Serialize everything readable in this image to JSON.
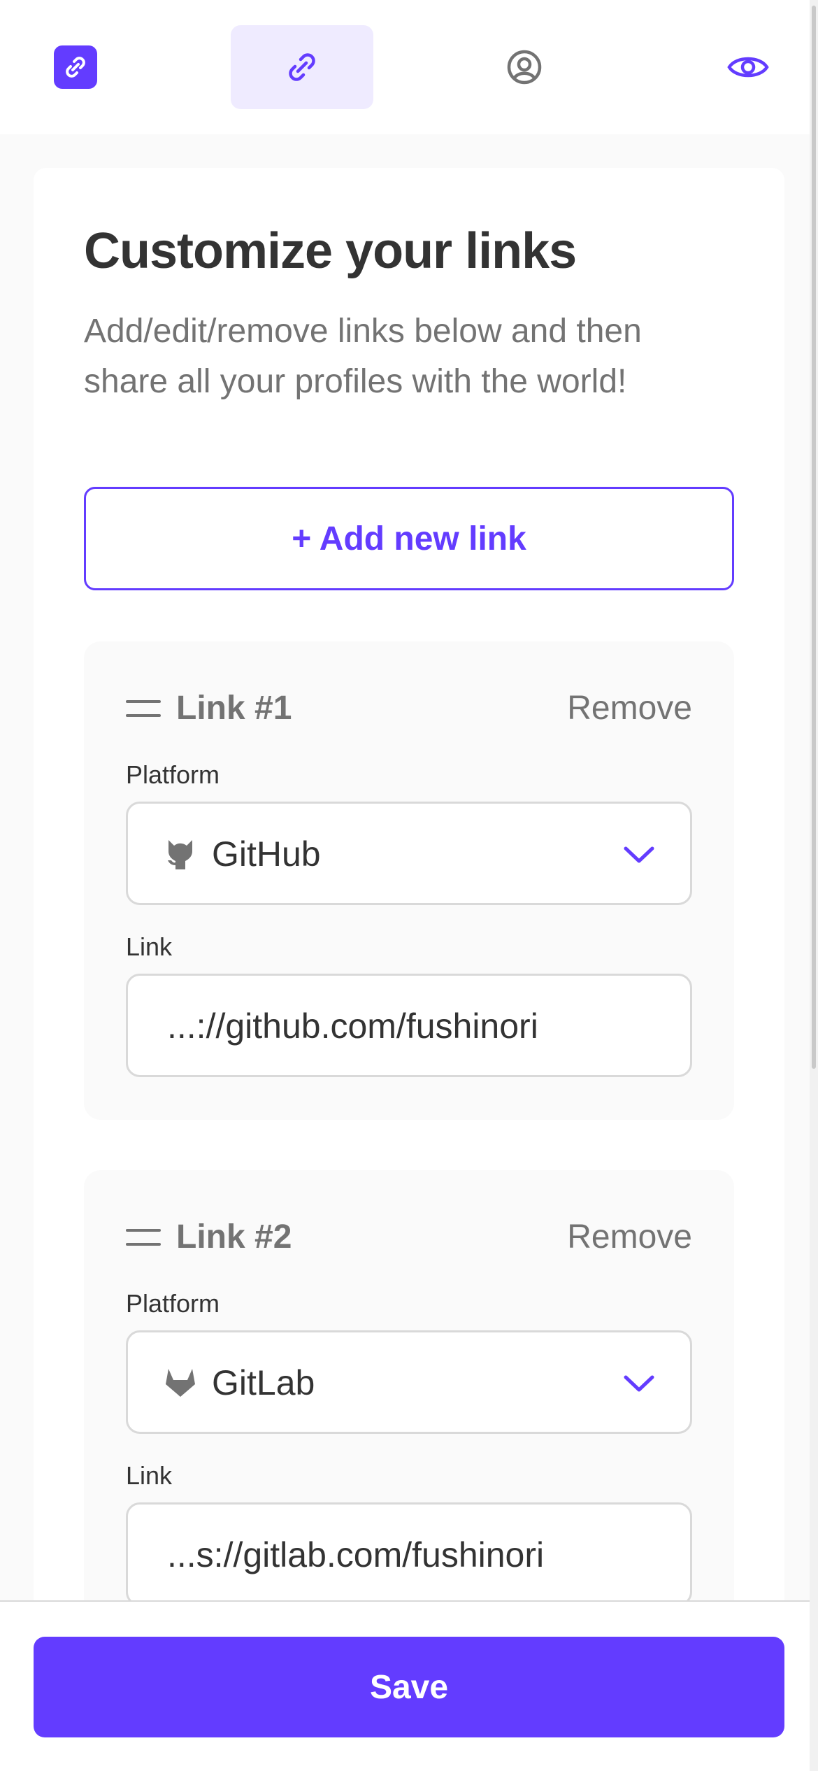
{
  "nav": {
    "logo_icon": "link-logo-icon",
    "tabs": [
      {
        "name": "links",
        "icon": "link-icon",
        "active": true
      },
      {
        "name": "profile",
        "icon": "user-circle-icon",
        "active": false
      }
    ],
    "preview_icon": "eye-icon"
  },
  "page": {
    "title": "Customize your links",
    "subtitle": "Add/edit/remove links below and then share all your profiles with the world!",
    "add_button_label": "+ Add new link"
  },
  "links": [
    {
      "title": "Link #1",
      "remove_label": "Remove",
      "platform_label": "Platform",
      "platform_value": "GitHub",
      "platform_icon": "github-icon",
      "link_label": "Link",
      "link_value": "...://github.com/fushinori"
    },
    {
      "title": "Link #2",
      "remove_label": "Remove",
      "platform_label": "Platform",
      "platform_value": "GitLab",
      "platform_icon": "gitlab-icon",
      "link_label": "Link",
      "link_value": "...s://gitlab.com/fushinori"
    }
  ],
  "footer": {
    "save_label": "Save"
  },
  "colors": {
    "accent": "#633CFF",
    "accent_light": "#EFEBFF",
    "text_dark": "#333333",
    "text_grey": "#737373",
    "border": "#D9D9D9",
    "background": "#FAFAFA"
  }
}
